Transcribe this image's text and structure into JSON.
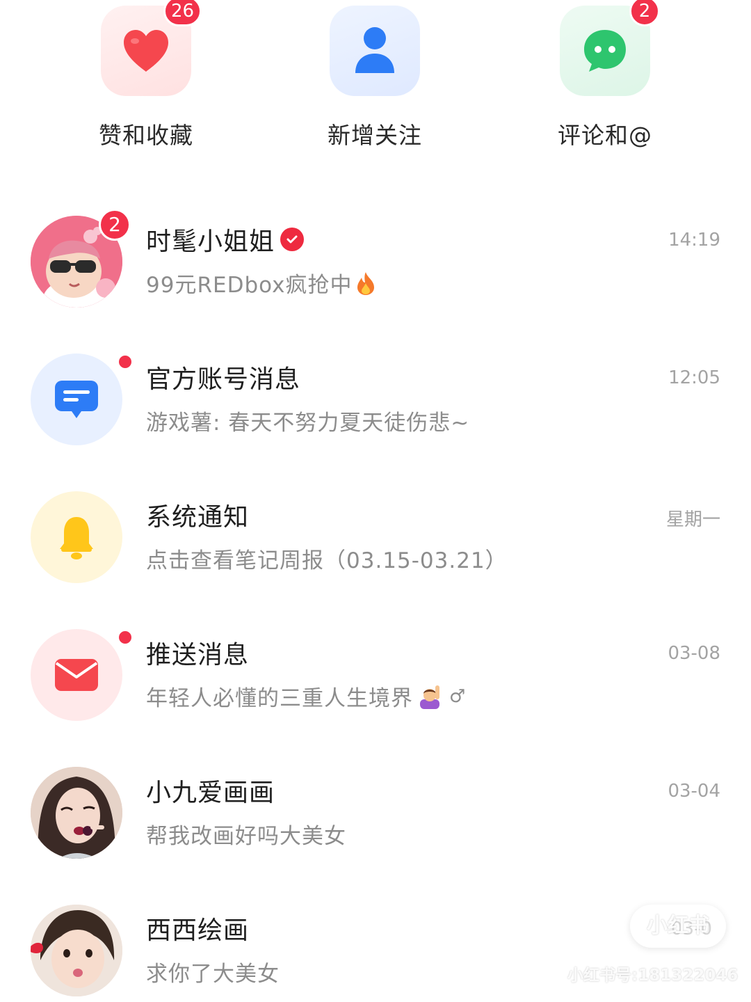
{
  "shortcuts": [
    {
      "label": "赞和收藏",
      "badge": "26",
      "icon": "heart-icon",
      "color": "#f5474e"
    },
    {
      "label": "新增关注",
      "badge": "",
      "icon": "person-icon",
      "color": "#2d7cf6"
    },
    {
      "label": "评论和@",
      "badge": "2",
      "icon": "chat-bubble-icon",
      "color": "#2ec56e"
    }
  ],
  "messages": [
    {
      "title": "时髦小姐姐",
      "preview": "99元REDbox疯抢中",
      "preview_emoji": "fire-icon",
      "time": "14:19",
      "unread": "2",
      "verified": true
    },
    {
      "title": "官方账号消息",
      "preview": "游戏薯: 春天不努力夏天徒伤悲~",
      "time": "12:05",
      "unread_dot": true,
      "icon": "message-icon"
    },
    {
      "title": "系统通知",
      "preview": "点击查看笔记周报（03.15-03.21）",
      "time": "星期一",
      "icon": "bell-icon"
    },
    {
      "title": "推送消息",
      "preview": "年轻人必懂的三重人生境界",
      "preview_emoji": "raising-hand-woman-emoji",
      "preview_suffix": "♂",
      "time": "03-08",
      "unread_dot": true,
      "icon": "envelope-icon"
    },
    {
      "title": "小九爱画画",
      "preview": "帮我改画好吗大美女",
      "time": "03-04"
    },
    {
      "title": "西西绘画",
      "preview": "求你了大美女",
      "time": "03-0"
    }
  ],
  "watermark": {
    "brand": "小红书",
    "user_id": "小红书号:181322046"
  },
  "colors": {
    "badge": "#f2314a",
    "title_text": "#1f1f1f",
    "preview_text": "#8c8c8c",
    "time_text": "#a3a3a3"
  }
}
